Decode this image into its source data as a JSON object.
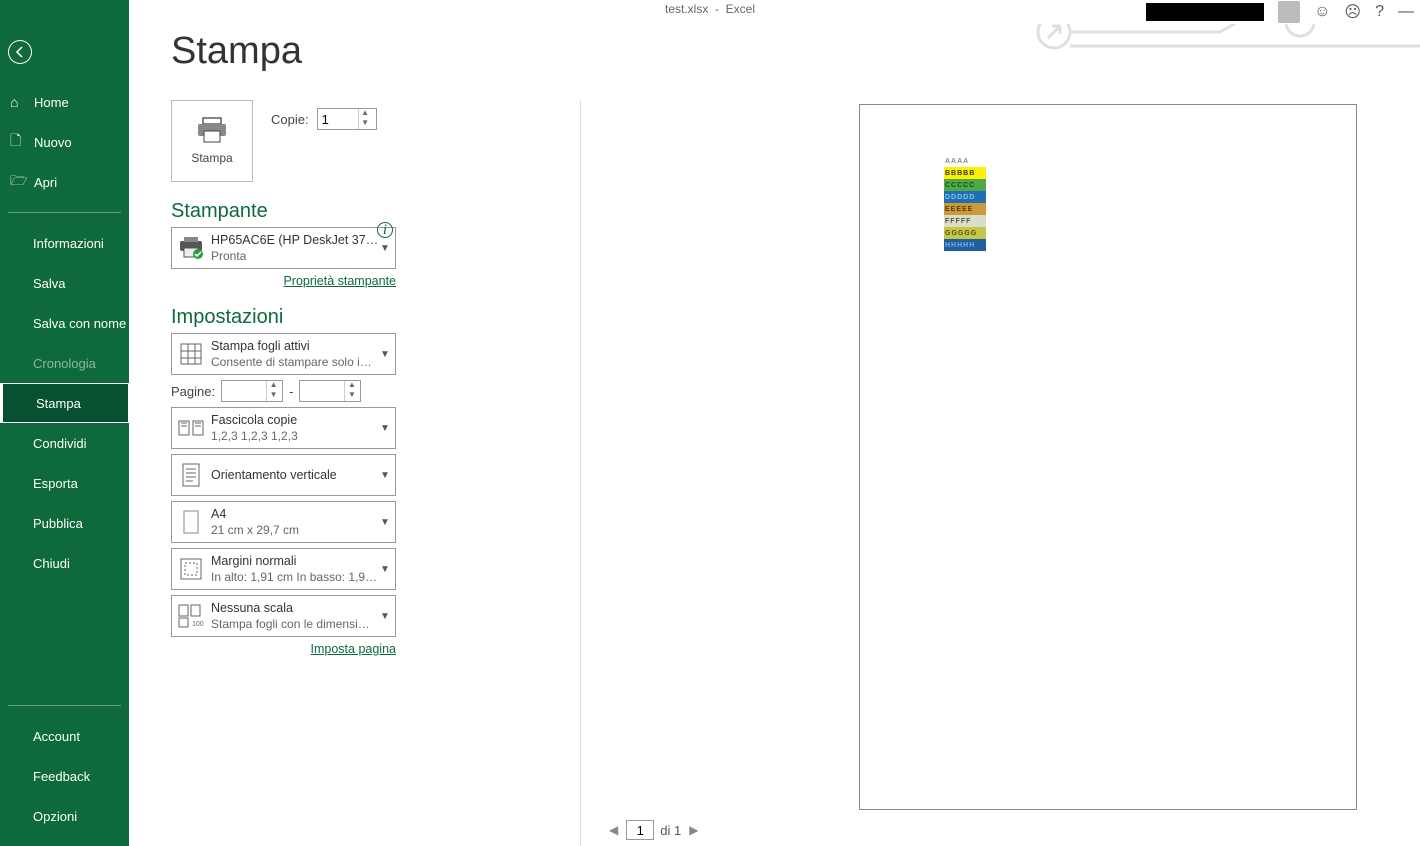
{
  "titlebar": {
    "filename": "test.xlsx",
    "sep": "-",
    "app": "Excel"
  },
  "sidebar": {
    "home": "Home",
    "nuovo": "Nuovo",
    "apri": "Apri",
    "informazioni": "Informazioni",
    "salva": "Salva",
    "salva_con_nome": "Salva con nome",
    "cronologia": "Cronologia",
    "stampa": "Stampa",
    "condividi": "Condividi",
    "esporta": "Esporta",
    "pubblica": "Pubblica",
    "chiudi": "Chiudi",
    "account": "Account",
    "feedback": "Feedback",
    "opzioni": "Opzioni"
  },
  "page": {
    "title": "Stampa"
  },
  "print": {
    "button_label": "Stampa",
    "copies_label": "Copie:",
    "copies_value": "1"
  },
  "printer": {
    "section": "Stampante",
    "name": "HP65AC6E (HP DeskJet 3700…",
    "status": "Pronta",
    "properties": "Proprietà stampante"
  },
  "settings": {
    "section": "Impostazioni",
    "what": {
      "l1": "Stampa fogli attivi",
      "l2": "Consente di stampare solo i…"
    },
    "pagine_label": "Pagine:",
    "pagine_sep": "-",
    "collate": {
      "l1": "Fascicola copie",
      "l2": "1,2,3    1,2,3    1,2,3"
    },
    "orient": {
      "l1": "Orientamento verticale"
    },
    "paper": {
      "l1": "A4",
      "l2": "21 cm x 29,7 cm"
    },
    "margins": {
      "l1": "Margini normali",
      "l2": "In alto: 1,91 cm In basso: 1,9…"
    },
    "scale": {
      "l1": "Nessuna scala",
      "l2": "Stampa fogli con le dimensi…"
    },
    "page_setup": "Imposta pagina"
  },
  "preview": {
    "rows": [
      {
        "text": "AAAA",
        "bg": "#ffffff",
        "fg": "#888888"
      },
      {
        "text": "BBBBB",
        "bg": "#fff200",
        "fg": "#333333"
      },
      {
        "text": "CCCCC",
        "bg": "#4ea94b",
        "fg": "#1a4d1a"
      },
      {
        "text": "DDDDD",
        "bg": "#1f6fb2",
        "fg": "#88c0e8"
      },
      {
        "text": "EEEEE",
        "bg": "#cc9a3b",
        "fg": "#5a3d0a"
      },
      {
        "text": "FFFFF",
        "bg": "#d9dec9",
        "fg": "#555544"
      },
      {
        "text": "GGGGG",
        "bg": "#c3c74a",
        "fg": "#555500"
      },
      {
        "text": "HHHHH",
        "bg": "#1f5fa0",
        "fg": "#7ab0dd"
      }
    ],
    "footer": {
      "page_value": "1",
      "of": "di 1"
    }
  }
}
